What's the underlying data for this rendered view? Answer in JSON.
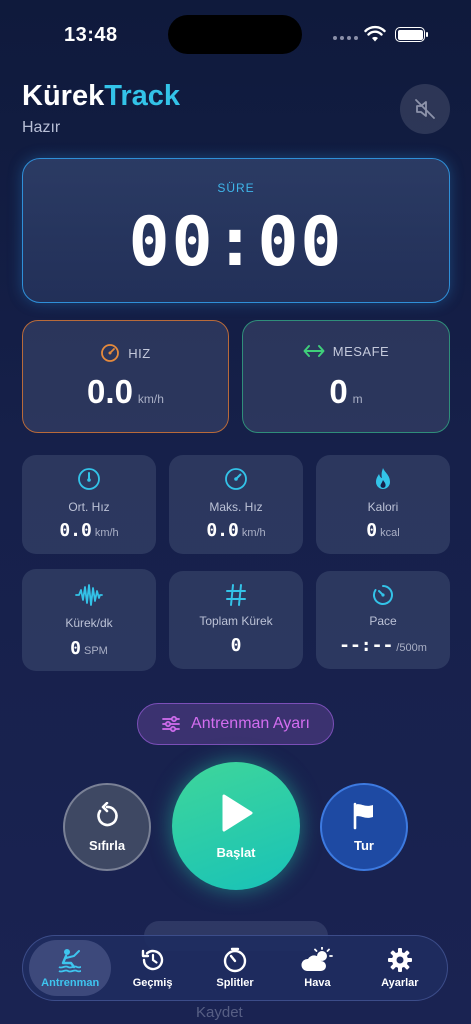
{
  "status_bar": {
    "time": "13:48"
  },
  "header": {
    "title_part1": "Kürek",
    "title_part2": "Track",
    "status": "Hazır"
  },
  "timer": {
    "label": "SÜRE",
    "value": "00:00"
  },
  "speed_card": {
    "label": "HIZ",
    "value": "0.0",
    "unit": "km/h"
  },
  "distance_card": {
    "label": "MESAFE",
    "value": "0",
    "unit": "m"
  },
  "stats": [
    {
      "label": "Ort. Hız",
      "value": "0.0",
      "unit": "km/h",
      "icon": "gauge-icon"
    },
    {
      "label": "Maks. Hız",
      "value": "0.0",
      "unit": "km/h",
      "icon": "speedometer-icon"
    },
    {
      "label": "Kalori",
      "value": "0",
      "unit": "kcal",
      "icon": "flame-icon"
    },
    {
      "label": "Kürek/dk",
      "value": "0",
      "unit": "SPM",
      "icon": "waveform-icon"
    },
    {
      "label": "Toplam Kürek",
      "value": "0",
      "unit": "",
      "icon": "hash-icon"
    },
    {
      "label": "Pace",
      "value": "--:--",
      "unit": "/500m",
      "icon": "timer-icon"
    }
  ],
  "settings_button": {
    "label": "Antrenman Ayarı"
  },
  "controls": {
    "reset_label": "Sıfırla",
    "start_label": "Başlat",
    "lap_label": "Tur"
  },
  "background": {
    "save_label": "Kaydet"
  },
  "tabs": [
    {
      "label": "Antrenman",
      "icon": "rowing-icon",
      "active": true
    },
    {
      "label": "Geçmiş",
      "icon": "history-icon",
      "active": false
    },
    {
      "label": "Splitler",
      "icon": "stopwatch-icon",
      "active": false
    },
    {
      "label": "Hava",
      "icon": "weather-icon",
      "active": false
    },
    {
      "label": "Ayarlar",
      "icon": "gear-icon",
      "active": false
    }
  ],
  "colors": {
    "accent_cyan": "#33c3e8",
    "speed_orange": "#e58a3c",
    "distance_green": "#3fcf7a",
    "settings_purple": "#d36df0",
    "start_green": "#3fd69a",
    "lap_blue": "#1e4aa3"
  }
}
